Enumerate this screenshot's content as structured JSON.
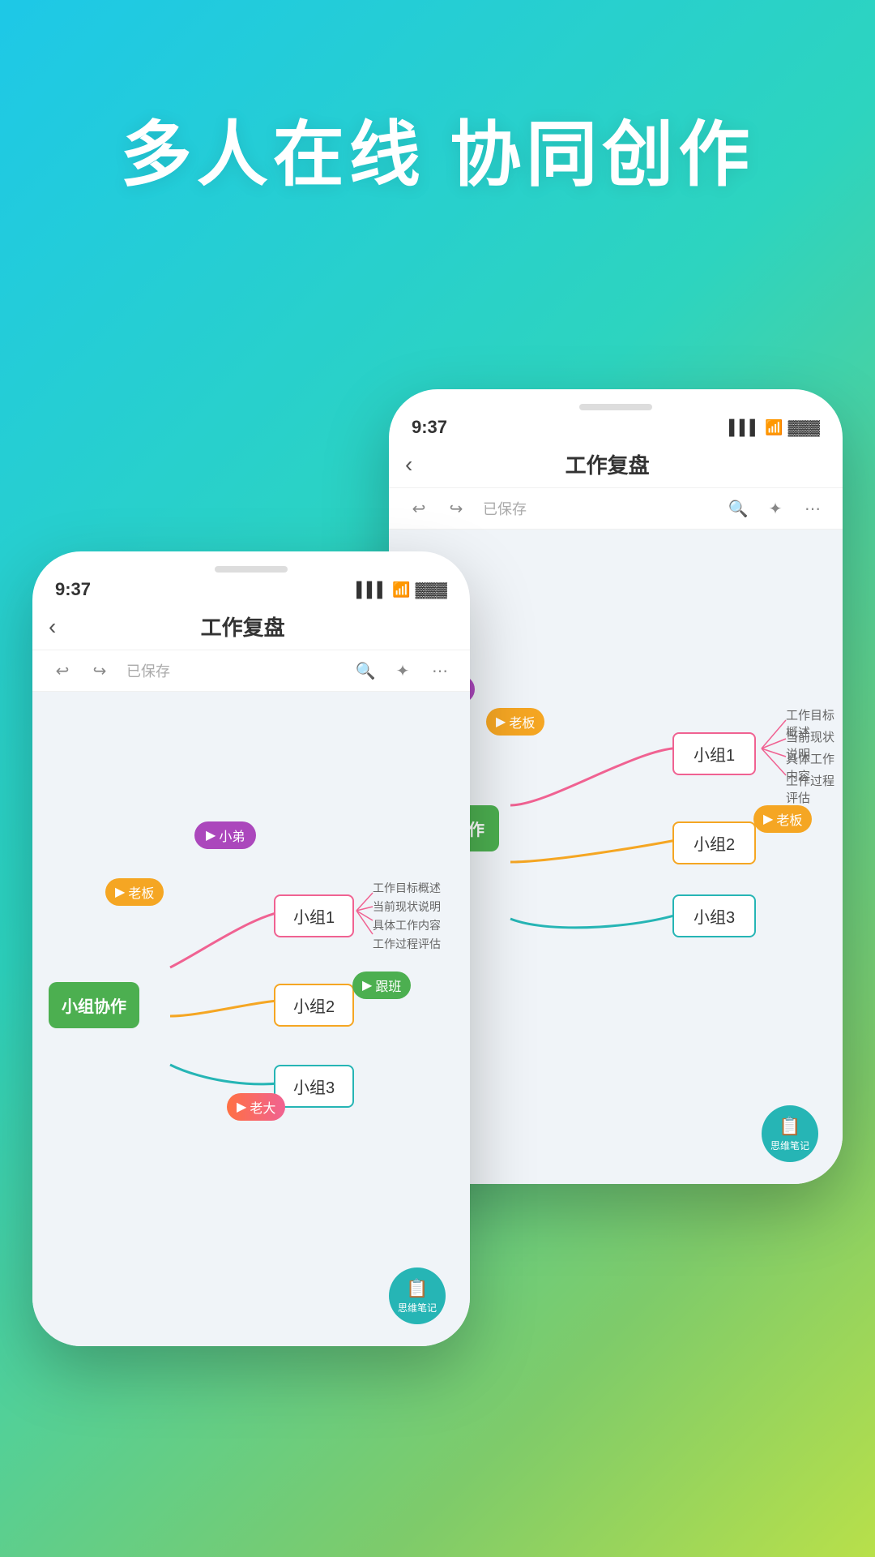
{
  "hero": {
    "line1": "多人在线 协同创作"
  },
  "colors": {
    "bg_gradient_start": "#1ec8e7",
    "bg_gradient_end": "#b8e04a",
    "green": "#4CAF50",
    "teal": "#26b5b5",
    "pink": "#f06292",
    "yellow": "#f5a623",
    "orange": "#ff7043",
    "purple": "#ab47bc",
    "accent_teal": "#00bcd4"
  },
  "phone_front": {
    "time": "9:37",
    "title": "工作复盘",
    "saved": "已保存",
    "center_node": "小组协作",
    "nodes": [
      {
        "id": "group1",
        "label": "小组1",
        "border_color": "#f06292"
      },
      {
        "id": "group2",
        "label": "小组2",
        "border_color": "#f5a623"
      },
      {
        "id": "group3",
        "label": "小组3",
        "border_color": "#26b5b5"
      }
    ],
    "sub_items": [
      "工作目标概述",
      "当前现状说明",
      "具体工作内容",
      "工作过程评估"
    ],
    "avatars": [
      {
        "label": "老板",
        "color": "#f5a623"
      },
      {
        "label": "小弟",
        "color": "#ab47bc"
      },
      {
        "label": "跟班",
        "color": "#4CAF50"
      },
      {
        "label": "老大",
        "color": "#ff7043"
      }
    ],
    "note_label": "思维笔记"
  },
  "phone_back": {
    "time": "9:37",
    "title": "工作复盘",
    "saved": "已保存",
    "nodes": [
      {
        "id": "group1",
        "label": "小组1",
        "border_color": "#f06292"
      },
      {
        "id": "group2",
        "label": "小组2",
        "border_color": "#f5a623"
      },
      {
        "id": "group3",
        "label": "小组3",
        "border_color": "#26b5b5"
      }
    ],
    "sub_items": [
      "工作目标概述",
      "当前现状说明",
      "具体工作内容",
      "工作过程评估"
    ],
    "avatars": [
      {
        "label": "老板",
        "color": "#f5a623"
      }
    ],
    "note_label": "思维笔记"
  }
}
